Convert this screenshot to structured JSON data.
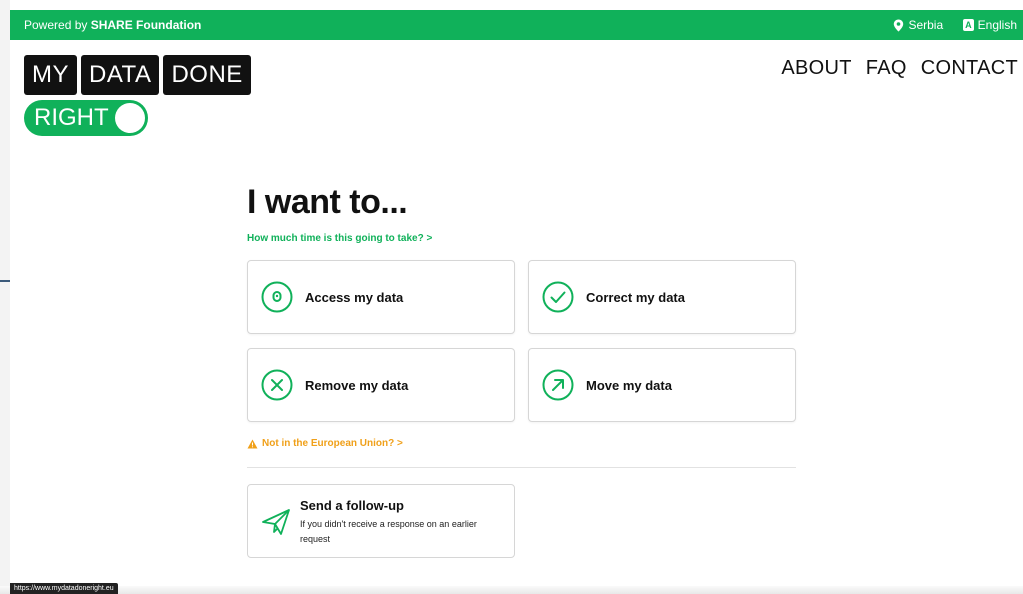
{
  "topbar": {
    "powered_prefix": "Powered by",
    "powered_org": "SHARE Foundation",
    "country": "Serbia",
    "language": "English",
    "language_icon_text": "A",
    "bg_color": "#10b15a"
  },
  "logo": {
    "words": [
      "MY",
      "DATA",
      "DONE"
    ],
    "toggle_word": "RIGHT"
  },
  "nav": {
    "about": "ABOUT",
    "faq": "FAQ",
    "contact": "CONTACT"
  },
  "main": {
    "heading": "I want to...",
    "time_link": "How much time is this going to take? >",
    "options": [
      {
        "label": "Access my data",
        "icon": "lock-icon"
      },
      {
        "label": "Correct my data",
        "icon": "check-icon"
      },
      {
        "label": "Remove my data",
        "icon": "x-icon"
      },
      {
        "label": "Move my data",
        "icon": "arrow-up-right-icon"
      }
    ],
    "not_eu": "Not in the European Union? >",
    "followup": {
      "title": "Send a follow-up",
      "subtitle": "If you didn't receive a response on an earlier request",
      "icon": "paper-plane-icon"
    }
  },
  "status_url": "https://www.mydatadoneright.eu",
  "colors": {
    "accent": "#10b15a",
    "warning": "#f0a019"
  }
}
